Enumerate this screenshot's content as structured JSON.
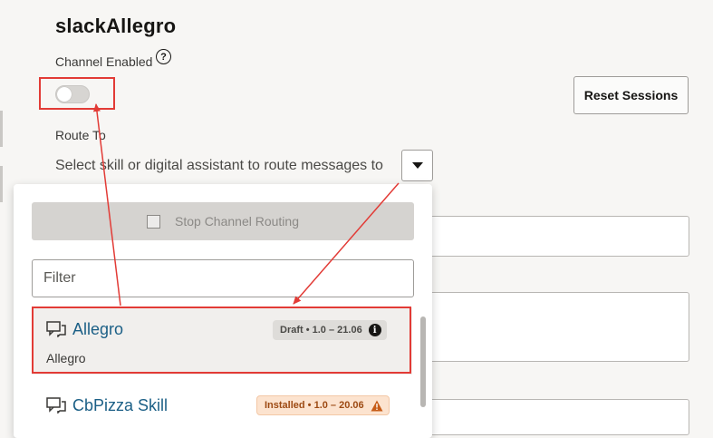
{
  "page": {
    "title": "slackAllegro",
    "channel_enabled_label": "Channel Enabled",
    "help_icon_glyph": "?",
    "channel_enabled_value": false,
    "reset_sessions_label": "Reset Sessions",
    "route_to_label": "Route To",
    "route_to_value": "Select skill or digital assistant to route messages to"
  },
  "dropdown": {
    "stop_routing_label": "Stop Channel Routing",
    "stop_routing_checked": false,
    "filter_placeholder": "Filter",
    "filter_value": "",
    "items": [
      {
        "name": "Allegro",
        "subtitle": "Allegro",
        "badge": "Draft • 1.0 – 21.06",
        "badge_icon": "info-icon",
        "status": "draft"
      },
      {
        "name": "CbPizza Skill",
        "subtitle": "",
        "badge": "Installed • 1.0 – 20.06",
        "badge_icon": "warning-icon",
        "status": "installed"
      }
    ]
  },
  "colors": {
    "highlight": "#e23b36",
    "link": "#1b5f86",
    "draft_badge_bg": "#dedcd9",
    "installed_badge_bg": "#fce3cf",
    "warning": "#c75c17"
  }
}
